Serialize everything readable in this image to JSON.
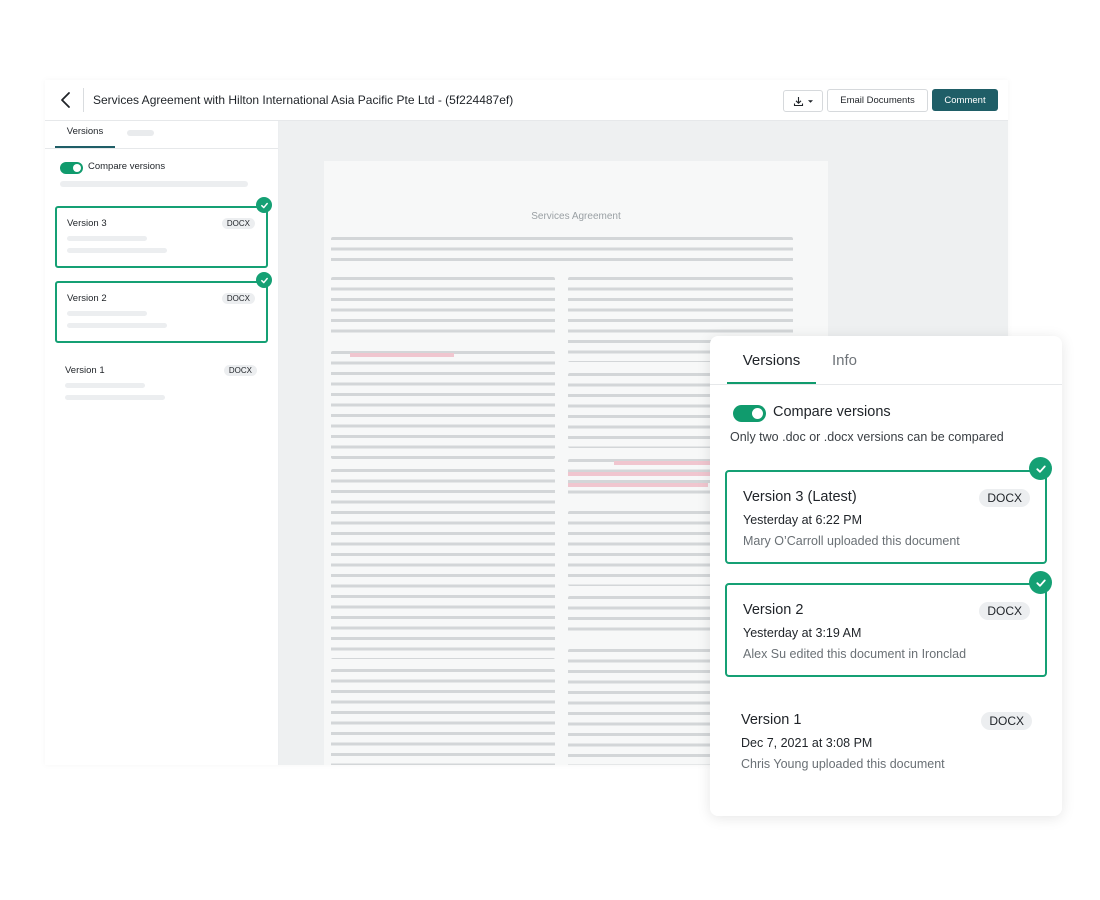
{
  "header": {
    "title": "Services Agreement with Hilton International Asia Pacific Pte Ltd - (5f224487ef)",
    "email_label": "Email Documents",
    "comment_label": "Comment"
  },
  "sidebar": {
    "tab_versions": "Versions",
    "compare_label": "Compare versions",
    "versions": [
      {
        "name": "Version 3",
        "badge": "DOCX"
      },
      {
        "name": "Version 2",
        "badge": "DOCX"
      },
      {
        "name": "Version 1",
        "badge": "DOCX"
      }
    ]
  },
  "document": {
    "title": "Services Agreement"
  },
  "panel": {
    "tab_versions": "Versions",
    "tab_info": "Info",
    "compare_label": "Compare versions",
    "note": "Only two .doc or .docx versions can be compared",
    "versions": [
      {
        "name": "Version 3 (Latest)",
        "badge": "DOCX",
        "date": "Yesterday at 6:22 PM",
        "by": "Mary O’Carroll uploaded this document"
      },
      {
        "name": "Version 2",
        "badge": "DOCX",
        "date": "Yesterday at 3:19 AM",
        "by": "Alex Su edited this document in Ironclad"
      },
      {
        "name": "Version 1",
        "badge": "DOCX",
        "date": "Dec 7, 2021 at 3:08 PM",
        "by": "Chris Young uploaded this document"
      }
    ]
  },
  "colors": {
    "accent": "#109b6d",
    "primary_button": "#1f5e67"
  }
}
